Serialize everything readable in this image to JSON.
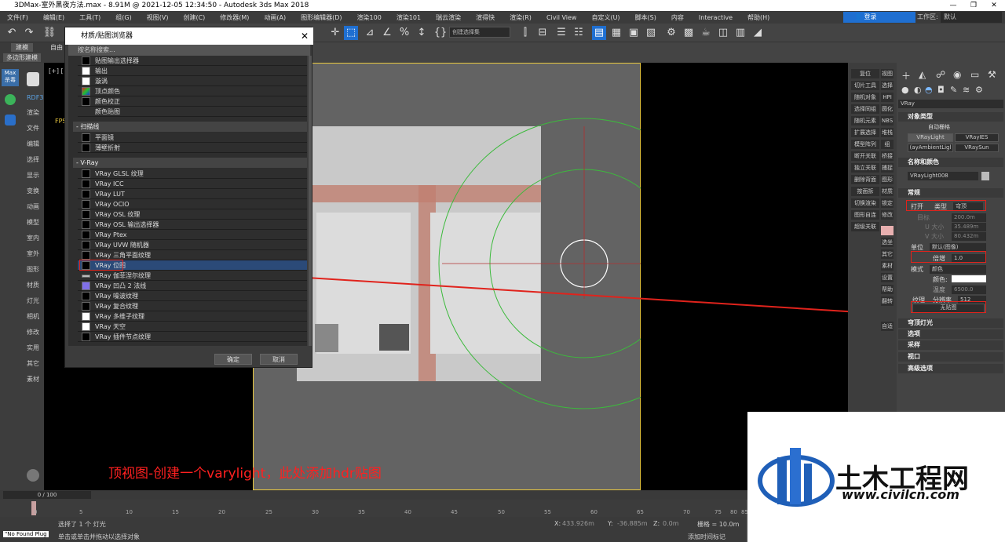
{
  "window": {
    "title": "3DMax-室外黑夜方法.max - 8.91M @ 2021-12-05 12:34:50 - Autodesk 3ds Max 2018",
    "controls": [
      "—",
      "❐",
      "✕"
    ]
  },
  "menubar": {
    "items": [
      "文件(F)",
      "编辑(E)",
      "工具(T)",
      "组(G)",
      "视图(V)",
      "创建(C)",
      "修改器(M)",
      "动画(A)",
      "图形编辑器(D)",
      "渲染100",
      "渲染101",
      "瑞云渲染",
      "渲得快",
      "渲染(R)",
      "Civil View",
      "自定义(U)",
      "脚本(S)",
      "内容",
      "Interactive",
      "帮助(H)"
    ],
    "login_label": "登录",
    "workspace_label": "工作区:",
    "workspace_value": "默认"
  },
  "toolbar": {
    "selection_set": "创建选择集"
  },
  "ribbon": {
    "tab1": "建模",
    "tab2": "自由",
    "sub": "多边形建模"
  },
  "left_dock": {
    "logo": "Max 杀毒",
    "items": [
      "RDF3",
      "渲染",
      "文件",
      "编辑",
      "选择",
      "显示",
      "变换",
      "动画",
      "模型",
      "室内",
      "室外",
      "图形",
      "材质",
      "灯光",
      "相机",
      "修改",
      "实用",
      "其它",
      "素材"
    ]
  },
  "viewport": {
    "left_label": "[+] [",
    "fps": "FPS"
  },
  "dialog": {
    "title": "材质/贴图浏览器",
    "close": "✕",
    "search_placeholder": "按名称搜索...",
    "rows_top": [
      {
        "label": "贴图输出选择器",
        "color": "#000000"
      },
      {
        "label": "输出",
        "color": "#ffffff"
      },
      {
        "label": "漩涡",
        "color": "#ffffff"
      },
      {
        "label": "顶点颜色",
        "color": "#39a84a"
      },
      {
        "label": "颜色校正",
        "color": "#000000"
      },
      {
        "label": "颜色贴图",
        "color": "#2e2e2e"
      }
    ],
    "group_scanline": "- 扫描线",
    "rows_scanline": [
      {
        "label": "平面镜",
        "color": "#000000"
      },
      {
        "label": "薄壁折射",
        "color": "#000000"
      }
    ],
    "group_vray": "- V-Ray",
    "rows_vray": [
      {
        "label": "VRay GLSL 纹理",
        "color": "#000000"
      },
      {
        "label": "VRay ICC",
        "color": "#000000"
      },
      {
        "label": "VRay LUT",
        "color": "#000000"
      },
      {
        "label": "VRay OCIO",
        "color": "#000000"
      },
      {
        "label": "VRay OSL 纹理",
        "color": "#000000"
      },
      {
        "label": "VRay OSL 输出选择器",
        "color": "#000000"
      },
      {
        "label": "VRay Ptex",
        "color": "#000000"
      },
      {
        "label": "VRay UVW 随机器",
        "color": "#000000"
      },
      {
        "label": "VRay 三角平面纹理",
        "color": "#000000"
      },
      {
        "label": "VRay 位图",
        "color": "#000000"
      },
      {
        "label": "VRay 伽菲涅尔纹理",
        "color": "#bbbbbb"
      },
      {
        "label": "VRay 凹凸 2 法线",
        "color": "#8070e8"
      },
      {
        "label": "VRay 噪波纹理",
        "color": "#000000"
      },
      {
        "label": "VRay 复合纹理",
        "color": "#000000"
      },
      {
        "label": "VRay 多维子纹理",
        "color": "#ffffff"
      },
      {
        "label": "VRay 天空",
        "color": "#ffffff"
      },
      {
        "label": "VRay 插件节点纹理",
        "color": "#000000"
      }
    ],
    "ok": "确定",
    "cancel": "取消"
  },
  "button_panel": {
    "left_col": [
      "复位",
      "切片工具",
      "随机对象",
      "选择同组",
      "随机元素",
      "扩展选择",
      "模型阵列",
      "断开关联",
      "独立关联",
      "删除背面",
      "按面拆",
      "切换渲染",
      "图形自连",
      "超级关联"
    ],
    "right_col": [
      "视图",
      "选择",
      "HPI",
      "圆化",
      "NBS",
      "堆栈",
      "组",
      "桥接",
      "捕捉",
      "图形",
      "材质",
      "锁定",
      "修改",
      "",
      "选坐",
      "其它",
      "素材",
      "设置",
      "帮助",
      "翻转",
      "自适"
    ]
  },
  "command_panel": {
    "category": "VRay",
    "section_object_type": "对象类型",
    "auto_grid": "自动栅格",
    "obj_buttons": [
      "VRayLight",
      "VRayIES",
      "(ayAmbientLigl",
      "VRaySun"
    ],
    "section_name_color": "名称和颜色",
    "object_name": "VRayLight008",
    "section_general": "常规",
    "on_label": "打开",
    "type_label": "类型",
    "type_value": "穹顶",
    "target_label": "目标",
    "target_value": "200.0m",
    "u_size_label": "U 大小",
    "u_size_value": "35.489m",
    "v_size_label": "V 大小",
    "v_size_value": "80.432m",
    "units_label": "单位",
    "units_value": "默认(图像)",
    "multiplier_label": "倍增",
    "multiplier_value": "1.0",
    "mode_label": "模式",
    "mode_value": "颜色",
    "color_label": "颜色:",
    "temp_label": "温度",
    "temp_value": "6500.0",
    "texture_label": "纹理",
    "resolution_label": "分辨率",
    "resolution_value": "512",
    "no_map": "无贴图",
    "sections_collapsed": [
      "穹顶灯光",
      "选项",
      "采样",
      "视口",
      "高级选项"
    ]
  },
  "annotation": "顶视图-创建一个varylight，此处添加hdr贴图",
  "timeline": {
    "frame_counter": "0 / 100",
    "ticks": [
      "0",
      "5",
      "10",
      "15",
      "20",
      "25",
      "30",
      "35",
      "40",
      "45",
      "50",
      "55",
      "60",
      "65",
      "70",
      "75",
      "80",
      "85"
    ]
  },
  "status": {
    "script": "\"No Found Plug",
    "selected": "选择了 1 个 灯光",
    "hint": "单击或单击并拖动以选择对象",
    "x_label": "X:",
    "x_value": "433.926m",
    "y_label": "Y:",
    "y_value": "-36.885m",
    "z_label": "Z:",
    "z_value": "0.0m",
    "grid": "栅格 = 10.0m",
    "add_time_tag": "添加时间标记"
  },
  "watermark": {
    "name": "土木工程网",
    "url": "www.civilcn.com"
  },
  "colors": {
    "accent": "#1f6fd1",
    "annotation_red": "#e0231c",
    "viewport_frame": "#e8c840"
  }
}
